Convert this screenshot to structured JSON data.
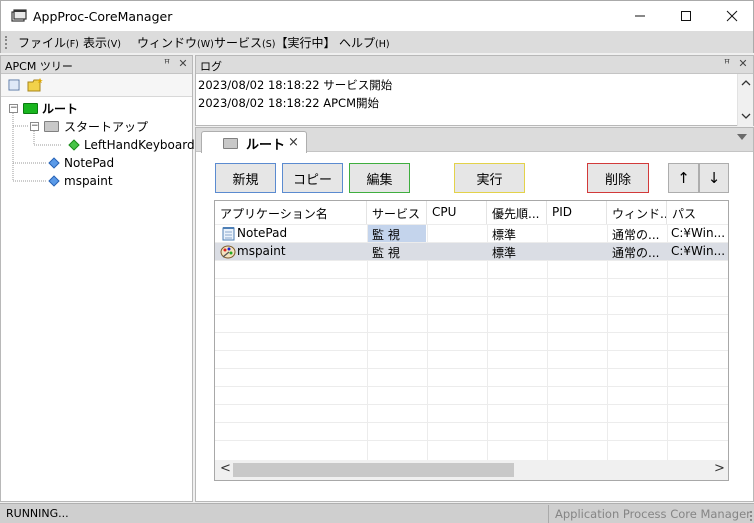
{
  "window": {
    "title": "AppProc-CoreManager",
    "minimize_glyph": "—",
    "maximize_glyph": "☐",
    "close_glyph": "✕"
  },
  "menu": [
    {
      "label": "ファイル",
      "key": "(F)"
    },
    {
      "label": "表示",
      "key": "(V)"
    },
    {
      "label": "ウィンドウ",
      "key": "(W)"
    },
    {
      "label": "サービス",
      "key": "(S)",
      "extra": "【実行中】"
    },
    {
      "label": "ヘルプ",
      "key": "(H)"
    }
  ],
  "tree_pane": {
    "title": "APCM ツリー",
    "pin_glyph": "ꟸ",
    "close_glyph": "✕",
    "nodes": [
      {
        "label": "ルート",
        "level": 0,
        "type": "folder-green",
        "expanded": true
      },
      {
        "label": "スタートアップ",
        "level": 1,
        "type": "folder-gray",
        "expanded": true
      },
      {
        "label": "LeftHandKeyboard",
        "level": 2,
        "type": "diamond-green"
      },
      {
        "label": "NotePad",
        "level": 1,
        "type": "diamond-blue"
      },
      {
        "label": "mspaint",
        "level": 1,
        "type": "diamond-blue"
      }
    ]
  },
  "log_pane": {
    "title": "ログ",
    "lines": [
      "2023/08/02 18:18:22 サービス開始",
      "2023/08/02 18:18:22 APCM開始"
    ]
  },
  "tab": {
    "label": "ルート",
    "close_glyph": "×"
  },
  "buttons": {
    "new": "新規",
    "copy": "コピー",
    "edit": "編集",
    "run": "実行",
    "delete": "削除",
    "up": "↑",
    "down": "↓"
  },
  "button_colors": {
    "new": "#5b8bd0",
    "copy": "#5b8bd0",
    "edit": "#3fae3f",
    "run": "#e3d24a",
    "delete": "#d23a3a"
  },
  "table": {
    "columns": [
      "アプリケーション名",
      "サービス",
      "CPU",
      "優先順...",
      "PID",
      "ウィンド...",
      "パス"
    ],
    "rows": [
      {
        "name": "NotePad",
        "service": "監 視",
        "cpu": "",
        "priority": "標準",
        "pid": "",
        "window": "通常の...",
        "path": "C:¥Win...",
        "icon": "notepad-icon"
      },
      {
        "name": "mspaint",
        "service": "監 視",
        "cpu": "",
        "priority": "標準",
        "pid": "",
        "window": "通常の...",
        "path": "C:¥Win...",
        "icon": "mspaint-icon"
      }
    ],
    "scroll_left": "<",
    "scroll_right": ">"
  },
  "status": {
    "left": "RUNNING...",
    "right": "Application Process Core Manager"
  }
}
